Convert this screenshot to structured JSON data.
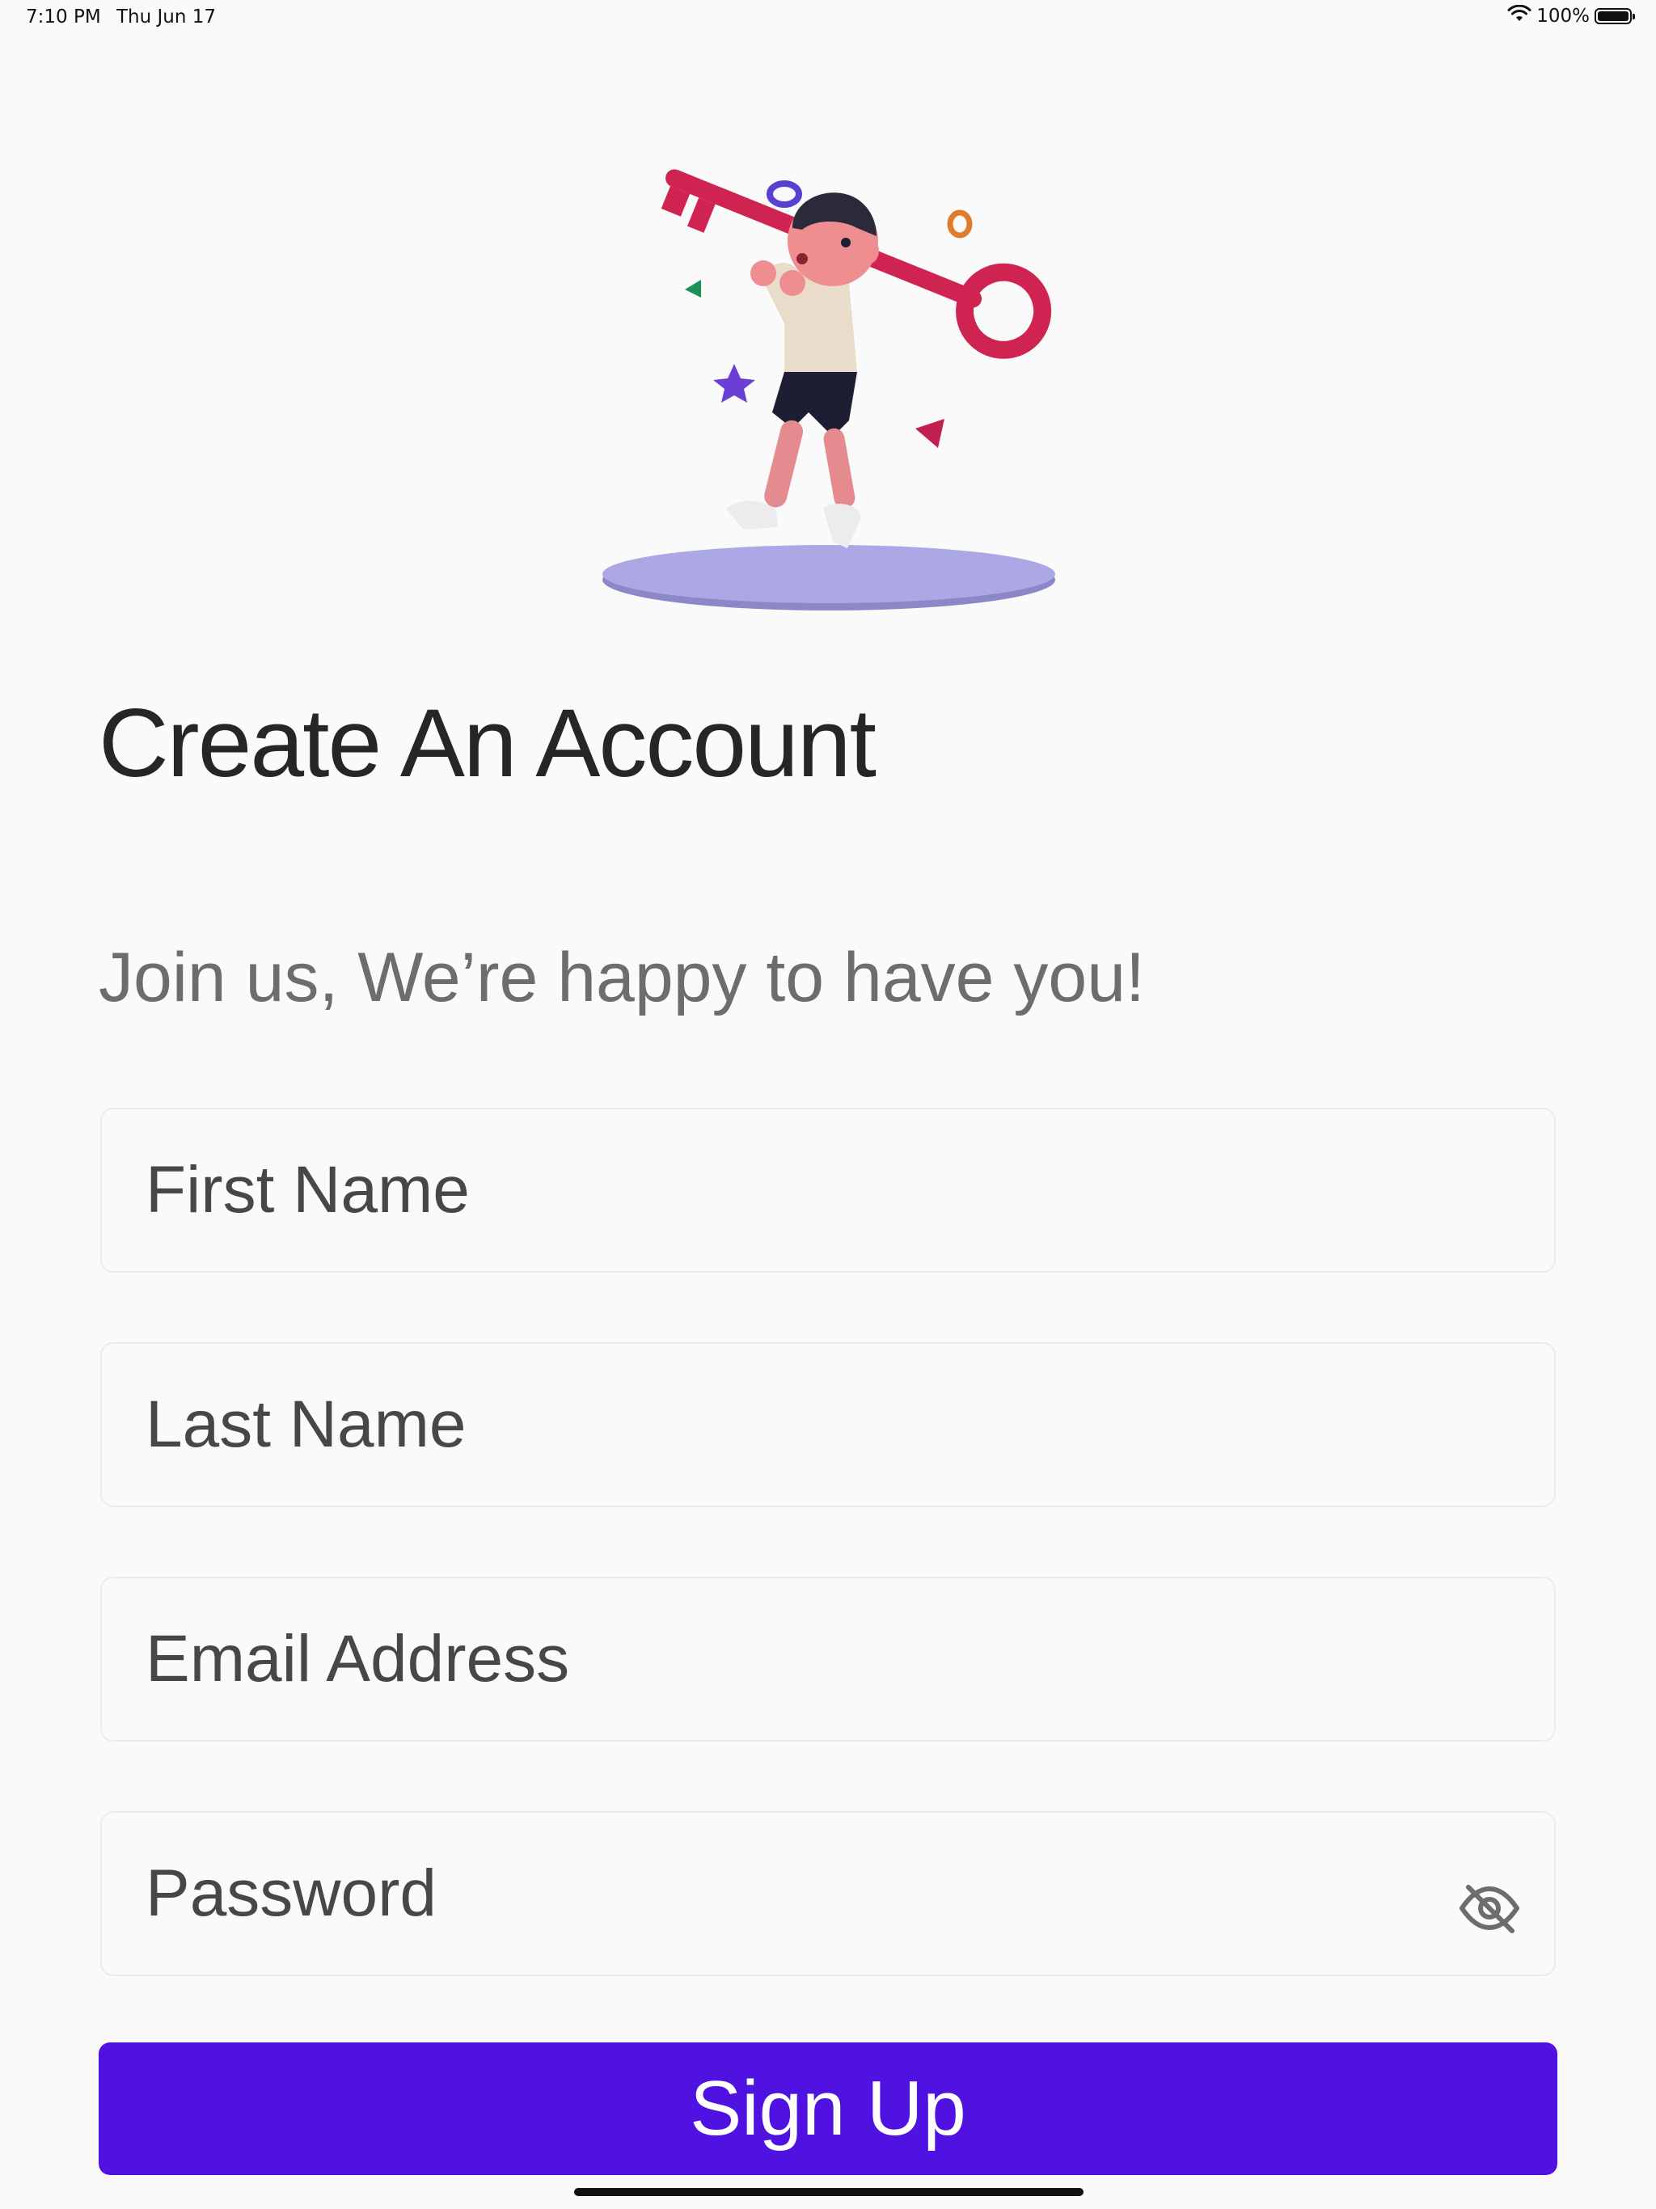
{
  "status_bar": {
    "time": "7:10 PM",
    "date": "Thu Jun 17",
    "battery": "100%",
    "battery_level": 1.0
  },
  "illustration": {
    "icon": "person-carrying-key-illustration"
  },
  "header": {
    "title": "Create An Account",
    "subtitle": "Join us, We’re happy to have you!"
  },
  "form": {
    "first_name": {
      "placeholder": "First Name",
      "value": ""
    },
    "last_name": {
      "placeholder": "Last Name",
      "value": ""
    },
    "email": {
      "placeholder": "Email Address",
      "value": ""
    },
    "password": {
      "placeholder": "Password",
      "value": "",
      "toggle_icon": "eye-slash-icon"
    },
    "submit_label": "Sign Up"
  },
  "colors": {
    "accent": "#4f12e0",
    "background": "#fafafa",
    "title": "#262626",
    "subtitle": "#6d6d6d"
  }
}
